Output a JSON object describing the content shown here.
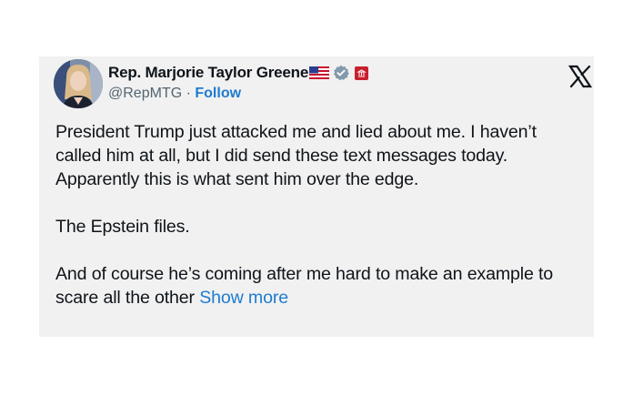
{
  "tweet": {
    "author": {
      "display_name": "Rep. Marjorie Taylor Greene",
      "handle": "@RepMTG",
      "separator": "·",
      "follow_label": "Follow",
      "badges": [
        "us-flag-icon",
        "verified-gray-check-icon",
        "government-affiliation-icon"
      ]
    },
    "paragraphs": [
      "President Trump just attacked me and lied about me. I haven’t called him at all, but I did send these text messages today. Apparently this is what sent him over the edge.",
      "The Epstein files.",
      "And of course he’s coming after me hard to make an example to scare all the other"
    ],
    "show_more_label": "Show more",
    "platform_logo": "x-logo-icon"
  },
  "colors": {
    "card_background": "#f1f1f1",
    "text_primary": "#0f1419",
    "text_secondary": "#536471",
    "link": "#1d7bd0",
    "verified_badge": "#829aab"
  }
}
